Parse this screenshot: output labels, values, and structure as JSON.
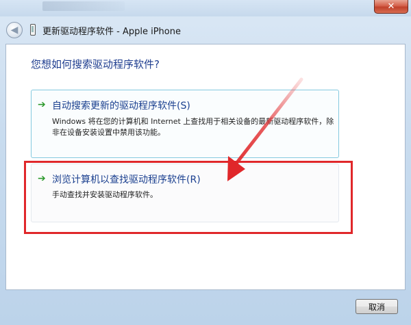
{
  "window": {
    "close_glyph": "✕",
    "title": "更新驱动程序软件 - Apple iPhone"
  },
  "nav": {
    "back_glyph": "◀"
  },
  "main": {
    "question": "您想如何搜索驱动程序软件?",
    "options": [
      {
        "arrow": "➔",
        "title": "自动搜索更新的驱动程序软件(S)",
        "description": "Windows 将在您的计算机和 Internet 上查找用于相关设备的最新驱动程序软件，除非在设备安装设置中禁用该功能。"
      },
      {
        "arrow": "➔",
        "title": "浏览计算机以查找驱动程序软件(R)",
        "description": "手动查找并安装驱动程序软件。"
      }
    ]
  },
  "footer": {
    "cancel_label": "取消"
  },
  "colors": {
    "highlight": "#e0272a",
    "link_blue": "#1a3f8f",
    "arrow_green": "#2e9a2e"
  },
  "icons": [
    "close-icon",
    "back-arrow-icon",
    "phone-device-icon",
    "green-arrow-icon"
  ]
}
